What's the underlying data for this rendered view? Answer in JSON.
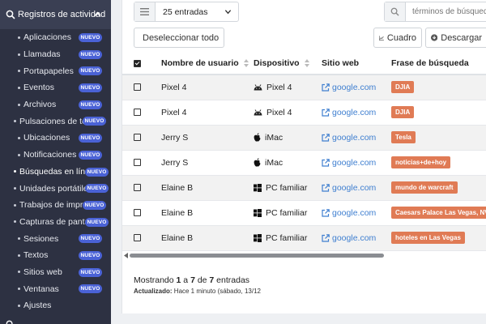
{
  "sidebar": {
    "header": "Registros de actividad",
    "badge": "NUEVO",
    "items": [
      {
        "label": "Aplicaciones",
        "kind": "sub",
        "badge": true
      },
      {
        "label": "Llamadas",
        "kind": "sub",
        "badge": true
      },
      {
        "label": "Portapapeles",
        "kind": "sub",
        "badge": true
      },
      {
        "label": "Eventos",
        "kind": "sub",
        "badge": true
      },
      {
        "label": "Archivos",
        "kind": "sub",
        "badge": true
      },
      {
        "label": "Pulsaciones de teclas",
        "kind": "top",
        "badge": true
      },
      {
        "label": "Ubicaciones",
        "kind": "sub",
        "badge": true
      },
      {
        "label": "Notificaciones",
        "kind": "sub",
        "badge": true
      },
      {
        "label": "Búsquedas en línea",
        "kind": "top",
        "badge": true,
        "active": true
      },
      {
        "label": "Unidades portátiles",
        "kind": "top",
        "badge": true
      },
      {
        "label": "Trabajos de impresión",
        "kind": "top",
        "badge": true
      },
      {
        "label": "Capturas de pantalla",
        "kind": "top",
        "badge": true
      },
      {
        "label": "Sesiones",
        "kind": "sub",
        "badge": true
      },
      {
        "label": "Textos",
        "kind": "sub",
        "badge": true
      },
      {
        "label": "Sitios web",
        "kind": "sub",
        "badge": true
      },
      {
        "label": "Ventanas",
        "kind": "sub",
        "badge": true
      },
      {
        "label": "Ajustes",
        "kind": "sub",
        "badge": false
      }
    ]
  },
  "toolbar": {
    "page_size": "25 entradas",
    "search_placeholder": "términos de búsqueda",
    "deselect_label": "Deseleccionar todo",
    "chart_label": "Cuadro",
    "download_label": "Descargar"
  },
  "table": {
    "columns": [
      "Nombre de usuario",
      "Dispositivo",
      "Sitio web",
      "Frase de búsqueda"
    ],
    "rows": [
      {
        "user": "Pixel 4",
        "device": "Pixel 4",
        "os": "android",
        "site": "google.com",
        "phrase": "DJIA"
      },
      {
        "user": "Pixel 4",
        "device": "Pixel 4",
        "os": "android",
        "site": "google.com",
        "phrase": "DJIA"
      },
      {
        "user": "Jerry S",
        "device": "iMac",
        "os": "apple",
        "site": "google.com",
        "phrase": "Tesla"
      },
      {
        "user": "Jerry S",
        "device": "iMac",
        "os": "apple",
        "site": "google.com",
        "phrase": "noticias+de+hoy"
      },
      {
        "user": "Elaine B",
        "device": "PC familiar",
        "os": "windows",
        "site": "google.com",
        "phrase": "mundo de warcraft"
      },
      {
        "user": "Elaine B",
        "device": "PC familiar",
        "os": "windows",
        "site": "google.com",
        "phrase": "Caesars Palace Las Vegas, NV"
      },
      {
        "user": "Elaine B",
        "device": "PC familiar",
        "os": "windows",
        "site": "google.com",
        "phrase": "hoteles en Las Vegas"
      }
    ]
  },
  "footer": {
    "showing_prefix": "Mostrando ",
    "showing_from": "1",
    "showing_mid1": " a ",
    "showing_to": "7",
    "showing_mid2": " de ",
    "showing_total": "7",
    "showing_suffix": " entradas",
    "updated_label": "Actualizado:",
    "updated_value": " Hace 1 minuto (sábado, 13/12"
  },
  "colors": {
    "sidebar_bg": "#2d3142",
    "badge": "#4a62d6",
    "tag": "#e07b55",
    "link": "#3f7fd0"
  }
}
